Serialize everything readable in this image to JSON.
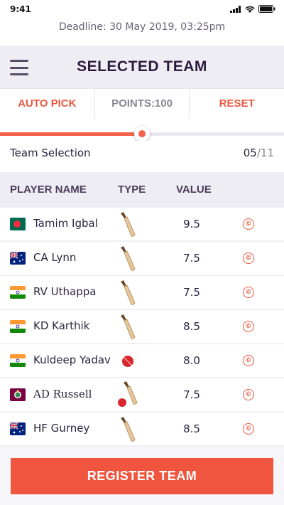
{
  "status_bar": {
    "time": "9:41"
  },
  "deadline": "Deadline: 30 May 2019, 03:25pm",
  "header": {
    "title": "SELECTED TEAM"
  },
  "tabs": [
    {
      "label": "AUTO PICK",
      "color": "#e8583f"
    },
    {
      "label": "POINTS:100",
      "color": "#8a8394"
    },
    {
      "label": "RESET",
      "color": "#e8583f"
    }
  ],
  "progress": {
    "fraction": 0.5,
    "fill_color": "#f4624a"
  },
  "selection": {
    "label": "Team Selection",
    "selected": "05",
    "total": "/11"
  },
  "columns": {
    "name": "PLAYER NAME",
    "type": "TYPE",
    "value": "VALUE"
  },
  "players": [
    {
      "name": "Tamim Igbal",
      "flag": "bangladesh-flag",
      "type_icon": "bat-icon",
      "value": "9.5",
      "captain_icon": "captain-c-icon"
    },
    {
      "name": "CA Lynn",
      "flag": "australia-flag",
      "type_icon": "bat-icon",
      "value": "7.5",
      "captain_icon": "captain-c-icon"
    },
    {
      "name": "RV Uthappa",
      "flag": "india-flag",
      "type_icon": "bat-icon",
      "value": "7.5",
      "captain_icon": "captain-c-icon"
    },
    {
      "name": "KD Karthik",
      "flag": "india-flag",
      "type_icon": "bat-icon",
      "value": "8.5",
      "captain_icon": "captain-c-icon"
    },
    {
      "name": "Kuldeep Yadav",
      "flag": "india-flag",
      "type_icon": "ball-icon",
      "value": "8.0",
      "captain_icon": "captain-c-icon"
    },
    {
      "name": "AD Russell",
      "flag": "west-indies-flag",
      "type_icon": "bat-ball-icon",
      "value": "7.5",
      "captain_icon": "captain-c-icon"
    },
    {
      "name": "HF Gurney",
      "flag": "australia-flag",
      "type_icon": "bat-icon",
      "value": "8.5",
      "captain_icon": "captain-c-icon"
    }
  ],
  "captain_glyph": "©",
  "register_button": "REGISTER TEAM",
  "colors": {
    "accent": "#f0563f",
    "header_bg": "#efedf4",
    "text_dark": "#2d1b3d"
  }
}
